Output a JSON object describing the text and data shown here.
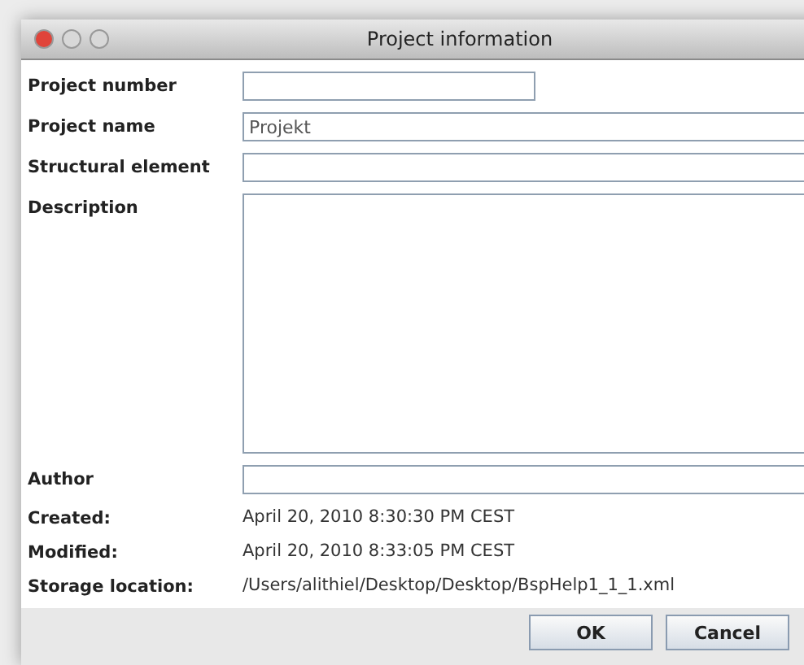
{
  "window": {
    "title": "Project information"
  },
  "fields": [
    {
      "kind": "short",
      "label": "Project number"
    },
    {
      "kind": "line",
      "label": "Project name",
      "value": "Projekt"
    },
    {
      "kind": "line",
      "label": "Structural element"
    },
    {
      "kind": "area",
      "label": "Description"
    },
    {
      "kind": "line",
      "label": "Author"
    },
    {
      "kind": "info",
      "label": "Created:",
      "value": "April 20, 2010 8:30:30 PM CEST"
    },
    {
      "kind": "info",
      "label": "Modified:",
      "value": "April 20, 2010 8:33:05 PM CEST"
    },
    {
      "kind": "info",
      "label": "Storage location:",
      "value": "/Users/alithiel/Desktop/Desktop/BspHelp1_1_1.xml"
    }
  ],
  "buttons": [
    "OK",
    "Cancel"
  ]
}
